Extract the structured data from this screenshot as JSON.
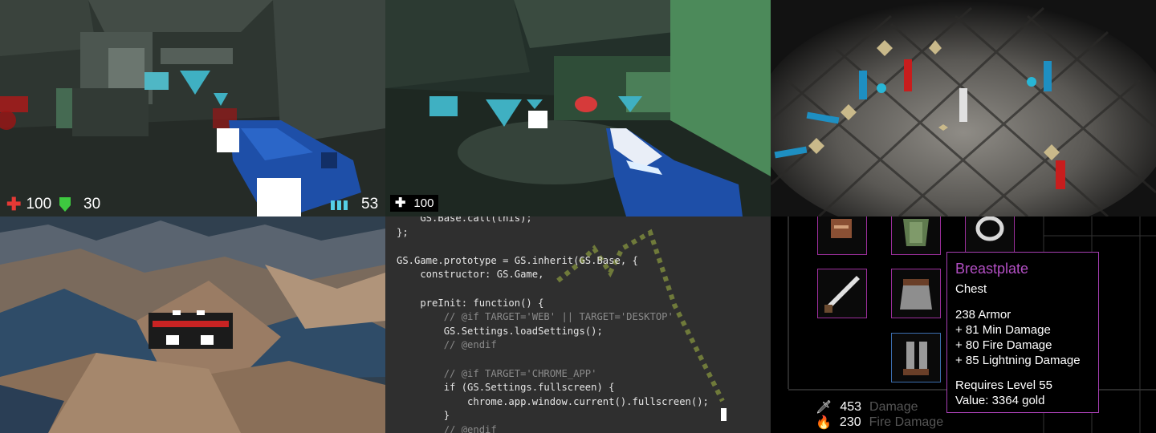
{
  "colors": {
    "accent_purple": "#b34fc4",
    "health_red": "#e53935",
    "armor_green": "#3ec940",
    "ammo_cyan": "#55d0e6",
    "weapon_blue": "#1e4fa8"
  },
  "fps1": {
    "health": "100",
    "armor": "30",
    "ammo": "53",
    "icons": [
      "health-cross-icon",
      "armor-shield-icon",
      "ammo-icon"
    ]
  },
  "fps2": {
    "health": "100",
    "icons": [
      "health-cross-icon"
    ]
  },
  "code": {
    "lines": [
      "    GS.Base.call(this);",
      "};",
      "",
      "GS.Game.prototype = GS.inherit(GS.Base, {",
      "    constructor: GS.Game,",
      "",
      "    preInit: function() {",
      "        // @if TARGET='WEB' || TARGET='DESKTOP'",
      "        GS.Settings.loadSettings();",
      "        // @endif",
      "",
      "        // @if TARGET='CHROME_APP'",
      "        if (GS.Settings.fullscreen) {",
      "            chrome.app.window.current().fullscreen();",
      "        }",
      "        // @endif"
    ]
  },
  "inventory": {
    "slot_icons": [
      "gloves-icon",
      "armor-icon",
      "ring-icon",
      "sword-icon",
      "chain-skirt-icon",
      "boots-icon"
    ],
    "tooltip": {
      "name": "Breastplate",
      "type": "Chest",
      "stats": [
        "238  Armor",
        "+ 81  Min Damage",
        "+ 80  Fire Damage",
        "+ 85  Lightning Damage"
      ],
      "requires": "Requires Level 55",
      "value": "Value:  3364 gold"
    },
    "character_stats": [
      {
        "icon": "sword-icon",
        "value": "453",
        "label": "Damage"
      },
      {
        "icon": "fire-icon",
        "value": "230",
        "label": "Fire Damage"
      }
    ]
  }
}
